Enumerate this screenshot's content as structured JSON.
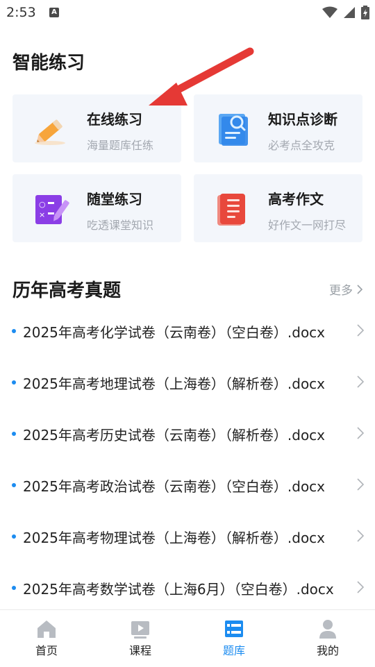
{
  "status_bar": {
    "time": "2:53",
    "notification_letter": "A"
  },
  "smart_practice": {
    "title": "智能练习",
    "cards": [
      {
        "title": "在线练习",
        "subtitle": "海量题库任练"
      },
      {
        "title": "知识点诊断",
        "subtitle": "必考点全攻克"
      },
      {
        "title": "随堂练习",
        "subtitle": "吃透课堂知识"
      },
      {
        "title": "高考作文",
        "subtitle": "好作文一网打尽"
      }
    ]
  },
  "past_exams": {
    "title": "历年高考真题",
    "more_label": "更多",
    "items": [
      "2025年高考化学试卷（云南卷）（空白卷）.docx",
      "2025年高考地理试卷（上海卷）（解析卷）.docx",
      "2025年高考历史试卷（云南卷）（解析卷）.docx",
      "2025年高考政治试卷（云南卷）（空白卷）.docx",
      "2025年高考物理试卷（上海卷）（解析卷）.docx",
      "2025年高考数学试卷（上海6月）（空白卷）.docx"
    ]
  },
  "tab_bar": {
    "active_index": 2,
    "tabs": [
      {
        "label": "首页",
        "icon": "home-icon"
      },
      {
        "label": "课程",
        "icon": "play-icon"
      },
      {
        "label": "题库",
        "icon": "question-bank-icon"
      },
      {
        "label": "我的",
        "icon": "person-icon"
      }
    ]
  },
  "colors": {
    "accent": "#1c8cf0",
    "card_bg": "#f3f6fb",
    "arrow": "#e53935"
  }
}
